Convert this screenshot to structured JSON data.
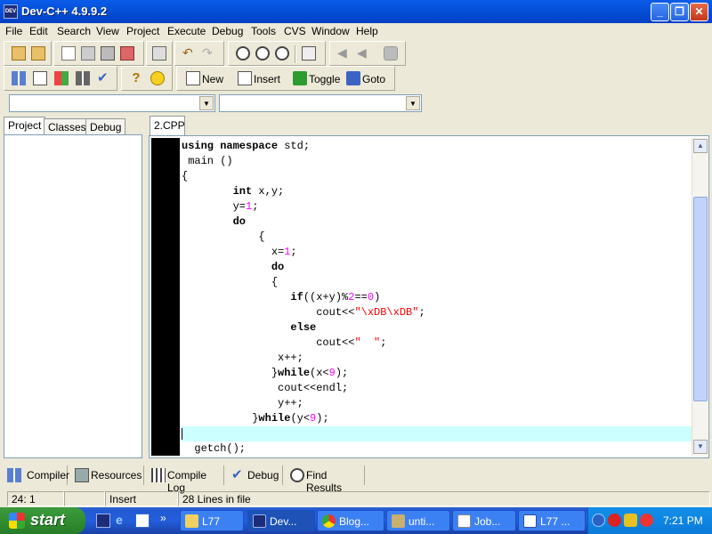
{
  "window": {
    "title": "Dev-C++ 4.9.9.2"
  },
  "menu": [
    "File",
    "Edit",
    "Search",
    "View",
    "Project",
    "Execute",
    "Debug",
    "Tools",
    "CVS",
    "Window",
    "Help"
  ],
  "toolbar": {
    "new_label": "New",
    "insert_label": "Insert",
    "toggle_label": "Toggle",
    "goto_label": "Goto"
  },
  "left_tabs": [
    "Project",
    "Classes",
    "Debug"
  ],
  "editor": {
    "file_tab": "2.CPP",
    "lines": [
      "using namespace std;",
      " main ()",
      "{",
      "        int x,y;",
      "        y=1;",
      "        do",
      "            {",
      "              x=1;",
      "              do",
      "              {",
      "                 if((x+y)%2==0)",
      "                     cout<<\"\\xDB\\xDB\";",
      "                 else",
      "                     cout<<\"  \";",
      "               x++;",
      "              }while(x<9);",
      "               cout<<endl;",
      "               y++;",
      "           }while(y<9);",
      "",
      "  getch();"
    ]
  },
  "bottom_tabs": [
    "Compiler",
    "Resources",
    "Compile Log",
    "Debug",
    "Find Results"
  ],
  "status": {
    "position": "24: 1",
    "mode": "Insert",
    "lines_info": "28 Lines in file"
  },
  "taskbar": {
    "start_label": "start",
    "tasks": [
      "L77",
      "Dev...",
      "Blog...",
      "unti...",
      "Job...",
      "L77 ..."
    ],
    "clock": "7:21 PM"
  }
}
